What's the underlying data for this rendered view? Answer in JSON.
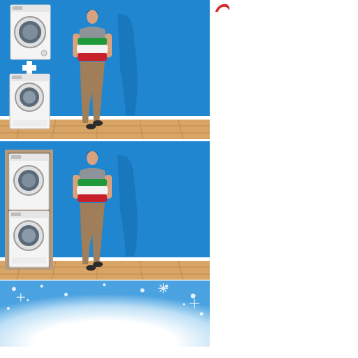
{
  "colors": {
    "wall": "#1f86cf",
    "wall_dark": "#1873b8",
    "floor": "#d9a566",
    "floor_line": "#c08a4c",
    "baseboard": "#ffffff",
    "appliance": "#f4f4f4",
    "appliance_edge": "#c9c9c9",
    "door_ring": "#9a9a9a",
    "drum": "#5a6a78",
    "shirt": "#8e9399",
    "pants": "#a07e5a",
    "shoes": "#2b2b2b",
    "skin": "#d8a27e",
    "hair": "#2a1d14",
    "flag_green": "#1f9a3a",
    "flag_white": "#f3f3f3",
    "flag_red": "#c8202b",
    "cabinet": "#b79b7d",
    "plus": "#ffffff",
    "snow_blue": "#4aa2e0",
    "santa_red": "#d42a2a",
    "santa_white": "#ffffff"
  },
  "icons": {
    "plus": "plus-icon",
    "santa_hat": "santa-hat-icon"
  }
}
